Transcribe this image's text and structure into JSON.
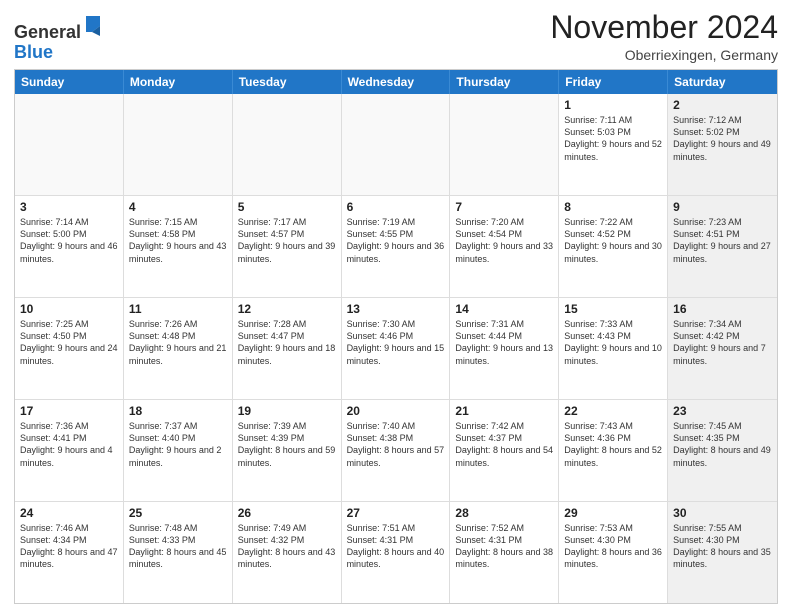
{
  "header": {
    "logo_general": "General",
    "logo_blue": "Blue",
    "month_title": "November 2024",
    "location": "Oberriexingen, Germany"
  },
  "calendar": {
    "days_of_week": [
      "Sunday",
      "Monday",
      "Tuesday",
      "Wednesday",
      "Thursday",
      "Friday",
      "Saturday"
    ],
    "rows": [
      [
        {
          "day": "",
          "info": "",
          "empty": true
        },
        {
          "day": "",
          "info": "",
          "empty": true
        },
        {
          "day": "",
          "info": "",
          "empty": true
        },
        {
          "day": "",
          "info": "",
          "empty": true
        },
        {
          "day": "",
          "info": "",
          "empty": true
        },
        {
          "day": "1",
          "info": "Sunrise: 7:11 AM\nSunset: 5:03 PM\nDaylight: 9 hours and 52 minutes.",
          "empty": false,
          "shaded": false
        },
        {
          "day": "2",
          "info": "Sunrise: 7:12 AM\nSunset: 5:02 PM\nDaylight: 9 hours and 49 minutes.",
          "empty": false,
          "shaded": true
        }
      ],
      [
        {
          "day": "3",
          "info": "Sunrise: 7:14 AM\nSunset: 5:00 PM\nDaylight: 9 hours and 46 minutes.",
          "empty": false,
          "shaded": false
        },
        {
          "day": "4",
          "info": "Sunrise: 7:15 AM\nSunset: 4:58 PM\nDaylight: 9 hours and 43 minutes.",
          "empty": false,
          "shaded": false
        },
        {
          "day": "5",
          "info": "Sunrise: 7:17 AM\nSunset: 4:57 PM\nDaylight: 9 hours and 39 minutes.",
          "empty": false,
          "shaded": false
        },
        {
          "day": "6",
          "info": "Sunrise: 7:19 AM\nSunset: 4:55 PM\nDaylight: 9 hours and 36 minutes.",
          "empty": false,
          "shaded": false
        },
        {
          "day": "7",
          "info": "Sunrise: 7:20 AM\nSunset: 4:54 PM\nDaylight: 9 hours and 33 minutes.",
          "empty": false,
          "shaded": false
        },
        {
          "day": "8",
          "info": "Sunrise: 7:22 AM\nSunset: 4:52 PM\nDaylight: 9 hours and 30 minutes.",
          "empty": false,
          "shaded": false
        },
        {
          "day": "9",
          "info": "Sunrise: 7:23 AM\nSunset: 4:51 PM\nDaylight: 9 hours and 27 minutes.",
          "empty": false,
          "shaded": true
        }
      ],
      [
        {
          "day": "10",
          "info": "Sunrise: 7:25 AM\nSunset: 4:50 PM\nDaylight: 9 hours and 24 minutes.",
          "empty": false,
          "shaded": false
        },
        {
          "day": "11",
          "info": "Sunrise: 7:26 AM\nSunset: 4:48 PM\nDaylight: 9 hours and 21 minutes.",
          "empty": false,
          "shaded": false
        },
        {
          "day": "12",
          "info": "Sunrise: 7:28 AM\nSunset: 4:47 PM\nDaylight: 9 hours and 18 minutes.",
          "empty": false,
          "shaded": false
        },
        {
          "day": "13",
          "info": "Sunrise: 7:30 AM\nSunset: 4:46 PM\nDaylight: 9 hours and 15 minutes.",
          "empty": false,
          "shaded": false
        },
        {
          "day": "14",
          "info": "Sunrise: 7:31 AM\nSunset: 4:44 PM\nDaylight: 9 hours and 13 minutes.",
          "empty": false,
          "shaded": false
        },
        {
          "day": "15",
          "info": "Sunrise: 7:33 AM\nSunset: 4:43 PM\nDaylight: 9 hours and 10 minutes.",
          "empty": false,
          "shaded": false
        },
        {
          "day": "16",
          "info": "Sunrise: 7:34 AM\nSunset: 4:42 PM\nDaylight: 9 hours and 7 minutes.",
          "empty": false,
          "shaded": true
        }
      ],
      [
        {
          "day": "17",
          "info": "Sunrise: 7:36 AM\nSunset: 4:41 PM\nDaylight: 9 hours and 4 minutes.",
          "empty": false,
          "shaded": false
        },
        {
          "day": "18",
          "info": "Sunrise: 7:37 AM\nSunset: 4:40 PM\nDaylight: 9 hours and 2 minutes.",
          "empty": false,
          "shaded": false
        },
        {
          "day": "19",
          "info": "Sunrise: 7:39 AM\nSunset: 4:39 PM\nDaylight: 8 hours and 59 minutes.",
          "empty": false,
          "shaded": false
        },
        {
          "day": "20",
          "info": "Sunrise: 7:40 AM\nSunset: 4:38 PM\nDaylight: 8 hours and 57 minutes.",
          "empty": false,
          "shaded": false
        },
        {
          "day": "21",
          "info": "Sunrise: 7:42 AM\nSunset: 4:37 PM\nDaylight: 8 hours and 54 minutes.",
          "empty": false,
          "shaded": false
        },
        {
          "day": "22",
          "info": "Sunrise: 7:43 AM\nSunset: 4:36 PM\nDaylight: 8 hours and 52 minutes.",
          "empty": false,
          "shaded": false
        },
        {
          "day": "23",
          "info": "Sunrise: 7:45 AM\nSunset: 4:35 PM\nDaylight: 8 hours and 49 minutes.",
          "empty": false,
          "shaded": true
        }
      ],
      [
        {
          "day": "24",
          "info": "Sunrise: 7:46 AM\nSunset: 4:34 PM\nDaylight: 8 hours and 47 minutes.",
          "empty": false,
          "shaded": false
        },
        {
          "day": "25",
          "info": "Sunrise: 7:48 AM\nSunset: 4:33 PM\nDaylight: 8 hours and 45 minutes.",
          "empty": false,
          "shaded": false
        },
        {
          "day": "26",
          "info": "Sunrise: 7:49 AM\nSunset: 4:32 PM\nDaylight: 8 hours and 43 minutes.",
          "empty": false,
          "shaded": false
        },
        {
          "day": "27",
          "info": "Sunrise: 7:51 AM\nSunset: 4:31 PM\nDaylight: 8 hours and 40 minutes.",
          "empty": false,
          "shaded": false
        },
        {
          "day": "28",
          "info": "Sunrise: 7:52 AM\nSunset: 4:31 PM\nDaylight: 8 hours and 38 minutes.",
          "empty": false,
          "shaded": false
        },
        {
          "day": "29",
          "info": "Sunrise: 7:53 AM\nSunset: 4:30 PM\nDaylight: 8 hours and 36 minutes.",
          "empty": false,
          "shaded": false
        },
        {
          "day": "30",
          "info": "Sunrise: 7:55 AM\nSunset: 4:30 PM\nDaylight: 8 hours and 35 minutes.",
          "empty": false,
          "shaded": true
        }
      ]
    ]
  }
}
